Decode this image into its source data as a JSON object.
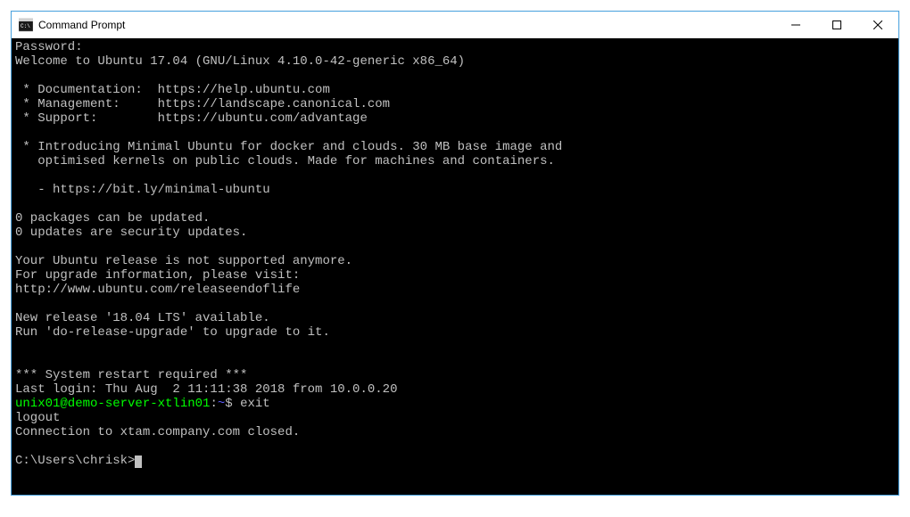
{
  "window": {
    "title": "Command Prompt"
  },
  "terminal": {
    "lines": {
      "l0": "Password:",
      "l1": "Welcome to Ubuntu 17.04 (GNU/Linux 4.10.0-42-generic x86_64)",
      "l2": "",
      "l3": " * Documentation:  https://help.ubuntu.com",
      "l4": " * Management:     https://landscape.canonical.com",
      "l5": " * Support:        https://ubuntu.com/advantage",
      "l6": "",
      "l7": " * Introducing Minimal Ubuntu for docker and clouds. 30 MB base image and",
      "l8": "   optimised kernels on public clouds. Made for machines and containers.",
      "l9": "",
      "l10": "   - https://bit.ly/minimal-ubuntu",
      "l11": "",
      "l12": "0 packages can be updated.",
      "l13": "0 updates are security updates.",
      "l14": "",
      "l15": "Your Ubuntu release is not supported anymore.",
      "l16": "For upgrade information, please visit:",
      "l17": "http://www.ubuntu.com/releaseendoflife",
      "l18": "",
      "l19": "New release '18.04 LTS' available.",
      "l20": "Run 'do-release-upgrade' to upgrade to it.",
      "l21": "",
      "l22": "",
      "l23": "*** System restart required ***",
      "l24": "Last login: Thu Aug  2 11:11:38 2018 from 10.0.0.20",
      "prompt_user": "unix01@demo-server-xtlin01",
      "prompt_colon": ":",
      "prompt_path": "~",
      "prompt_dollar": "$ ",
      "prompt_cmd": "exit",
      "l26": "logout",
      "l27": "Connection to xtam.company.com closed.",
      "l28": "",
      "l29": "C:\\Users\\chrisk>"
    }
  }
}
